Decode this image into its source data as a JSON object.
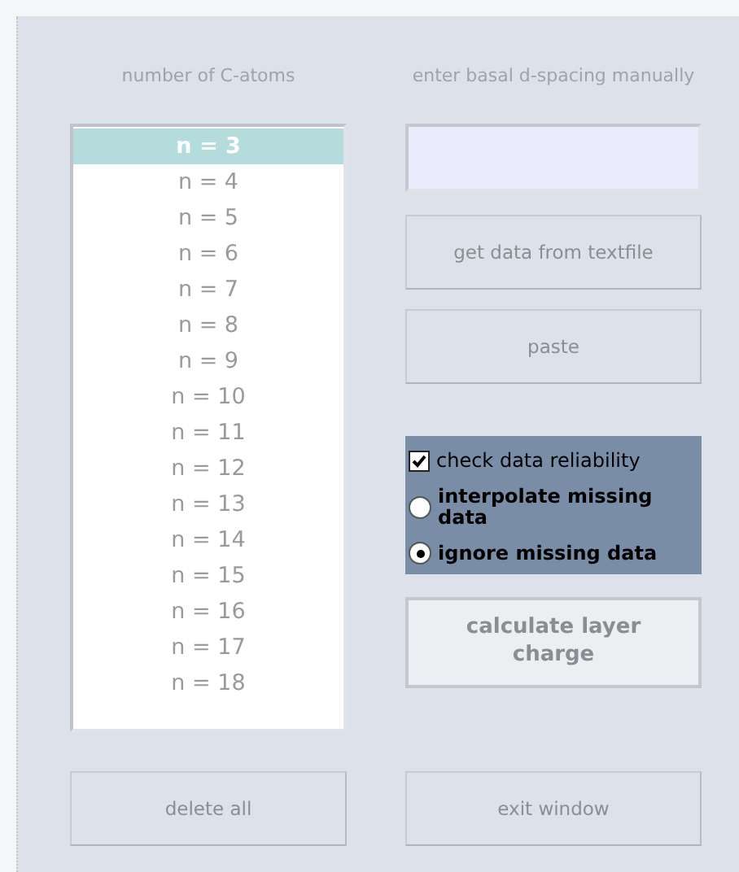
{
  "list": {
    "heading": "number of C-atoms",
    "items": [
      {
        "label": "n = 3",
        "selected": true
      },
      {
        "label": "n = 4",
        "selected": false
      },
      {
        "label": "n = 5",
        "selected": false
      },
      {
        "label": "n = 6",
        "selected": false
      },
      {
        "label": "n = 7",
        "selected": false
      },
      {
        "label": "n = 8",
        "selected": false
      },
      {
        "label": "n = 9",
        "selected": false
      },
      {
        "label": "n = 10",
        "selected": false
      },
      {
        "label": "n = 11",
        "selected": false
      },
      {
        "label": "n = 12",
        "selected": false
      },
      {
        "label": "n = 13",
        "selected": false
      },
      {
        "label": "n = 14",
        "selected": false
      },
      {
        "label": "n = 15",
        "selected": false
      },
      {
        "label": "n = 16",
        "selected": false
      },
      {
        "label": "n = 17",
        "selected": false
      },
      {
        "label": "n = 18",
        "selected": false
      }
    ]
  },
  "manual": {
    "heading": "enter basal d-spacing manually"
  },
  "buttons": [
    {
      "label": "get data from textfile",
      "kind": "normal",
      "disabled": true
    },
    {
      "label": "paste",
      "kind": "normal",
      "disabled": true
    }
  ],
  "options": {
    "check": {
      "label": "check data reliability",
      "checked": true
    },
    "radios": [
      {
        "label": "interpolate missing data",
        "selected": false
      },
      {
        "label": "ignore missing data",
        "selected": true
      }
    ]
  },
  "calculate": {
    "label": "calculate layer charge",
    "kind": "default",
    "disabled": true
  },
  "bottom_buttons": [
    {
      "label": "delete all",
      "kind": "normal",
      "disabled": true
    },
    {
      "label": "exit window",
      "kind": "normal",
      "disabled": true
    }
  ]
}
